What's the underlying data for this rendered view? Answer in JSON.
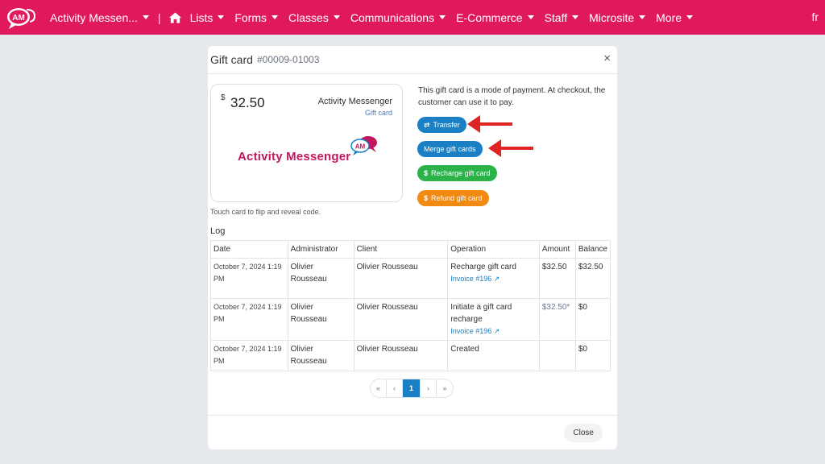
{
  "nav": {
    "items": [
      {
        "label": "Activity Messen...",
        "has_caret": true
      },
      {
        "label": "Lists",
        "has_caret": true
      },
      {
        "label": "Forms",
        "has_caret": true
      },
      {
        "label": "Classes",
        "has_caret": true
      },
      {
        "label": "Communications",
        "has_caret": true
      },
      {
        "label": "E-Commerce",
        "has_caret": true
      },
      {
        "label": "Staff",
        "has_caret": true
      },
      {
        "label": "Microsite",
        "has_caret": true
      },
      {
        "label": "More",
        "has_caret": true
      }
    ],
    "separator": "|",
    "language": "fr",
    "logo_text": "AM",
    "home_icon": "home-icon",
    "color": "#e0195f"
  },
  "modal": {
    "title": "Gift card",
    "number": "#00009-01003",
    "close_glyph": "×",
    "card": {
      "currency": "$",
      "amount": "32.50",
      "brand": "Activity Messenger",
      "type": "Gift card",
      "logo_text": "Activity Messenger",
      "logo_badge": "AM"
    },
    "touch_hint": "Touch card to flip and reveal code.",
    "description": "This gift card is a mode of payment. At checkout, the customer can use it to pay.",
    "buttons": {
      "transfer": {
        "label": "Transfer",
        "icon": "⇄"
      },
      "merge": {
        "label": "Merge gift cards"
      },
      "recharge": {
        "label": "Recharge gift card",
        "icon": "$"
      },
      "refund": {
        "label": "Refund gift card",
        "icon": "$"
      }
    },
    "log": {
      "label": "Log",
      "columns": [
        "Date",
        "Administrator",
        "Client",
        "Operation",
        "Amount",
        "Balance"
      ],
      "rows": [
        {
          "date": "October 7, 2024 1:19 PM",
          "admin": "Olivier Rousseau",
          "client": "Olivier Rousseau",
          "operation": "Recharge gift card",
          "invoice": "Invoice #196",
          "amount": "$32.50",
          "balance": "$32.50"
        },
        {
          "date": "October 7, 2024 1:19 PM",
          "admin": "Olivier Rousseau",
          "client": "Olivier Rousseau",
          "operation": "Initiate a gift card recharge",
          "invoice": "Invoice #196",
          "amount": "$32.50*",
          "balance": "$0"
        },
        {
          "date": "October 7, 2024 1:19 PM",
          "admin": "Olivier Rousseau",
          "client": "Olivier Rousseau",
          "operation": "Created",
          "invoice": "",
          "amount": "",
          "balance": "$0"
        }
      ]
    },
    "pagination": {
      "first": "«",
      "prev": "‹",
      "current": "1",
      "next": "›",
      "last": "»"
    },
    "close_label": "Close"
  },
  "colors": {
    "brand": "#e0195f",
    "primary": "#1a7fc4",
    "success": "#2bb34a",
    "warning": "#f08a12",
    "annotation_arrow": "#e02424"
  }
}
